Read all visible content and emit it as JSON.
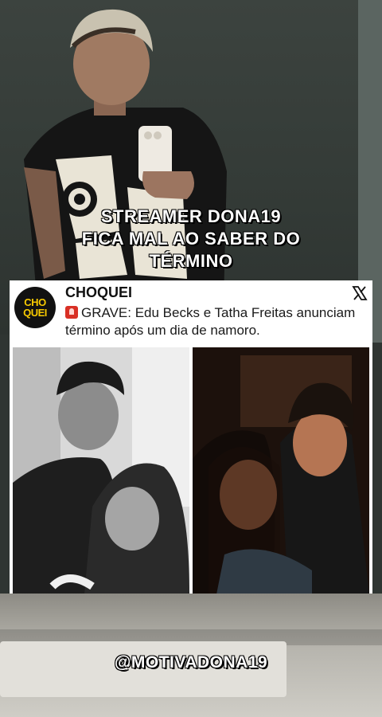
{
  "video": {
    "headline_lines": [
      "STREAMER DONA19",
      "FICA MAL AO SABER DO",
      "TÉRMINO"
    ],
    "watermark_handle": "@MOTIVADONA19"
  },
  "tweet": {
    "account_name": "CHOQUEI",
    "logo_text": [
      "CHO",
      "QUEI"
    ],
    "platform_icon": "x-logo-icon",
    "emoji_icon": "police-siren-icon",
    "text": "GRAVE: Edu Becks e Tatha Freitas anunciam término após um dia de namoro.",
    "photos": [
      "couple-photo-black-and-white",
      "couple-photo-night"
    ]
  },
  "colors": {
    "logo_yellow": "#f7c900",
    "logo_black": "#111111",
    "siren_red": "#d93025",
    "card_bg": "#ffffff",
    "caption_text": "#ffffff"
  }
}
